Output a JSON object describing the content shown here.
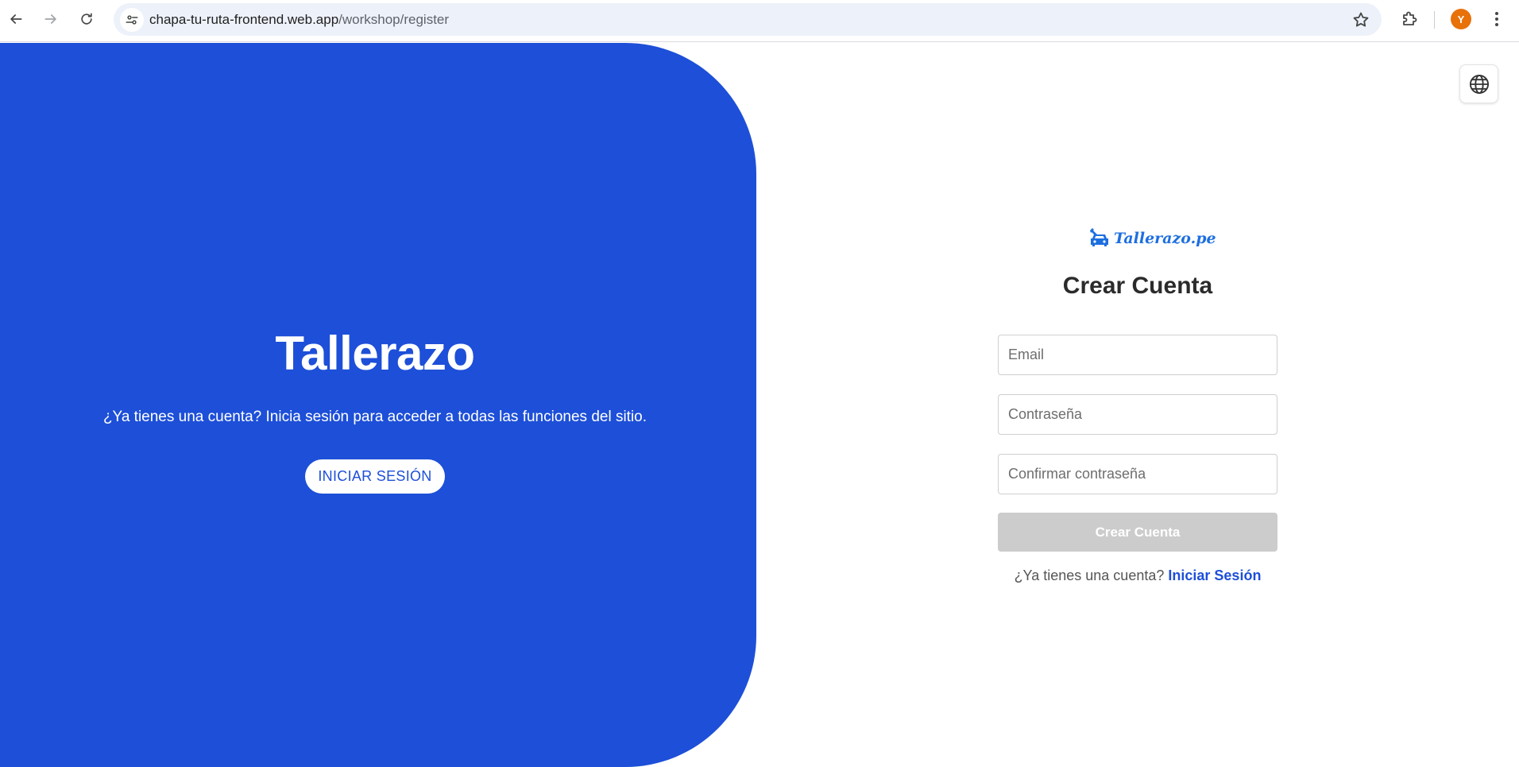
{
  "browser": {
    "url_host": "chapa-tu-ruta-frontend.web.app",
    "url_path": "/workshop/register",
    "avatar_initial": "Y",
    "avatar_color": "#e8710a"
  },
  "hero": {
    "title": "Tallerazo",
    "subtitle": "¿Ya tienes una cuenta? Inicia sesión para acceder a todas las funciones del sitio.",
    "login_button": "INICIAR SESIÓN",
    "background_color": "#1d4fd8"
  },
  "language_button": {
    "icon": "globe-icon"
  },
  "form": {
    "logo_text": "Tallerazo.pe",
    "logo_icon": "car-wrench-icon",
    "title": "Crear Cuenta",
    "email_placeholder": "Email",
    "password_placeholder": "Contraseña",
    "confirm_placeholder": "Confirmar contraseña",
    "submit_label": "Crear Cuenta",
    "have_account_text": "¿Ya tienes una cuenta?",
    "login_link": "Iniciar Sesión",
    "accent_color": "#1d4fd8",
    "disabled_button_color": "#cccccc"
  }
}
